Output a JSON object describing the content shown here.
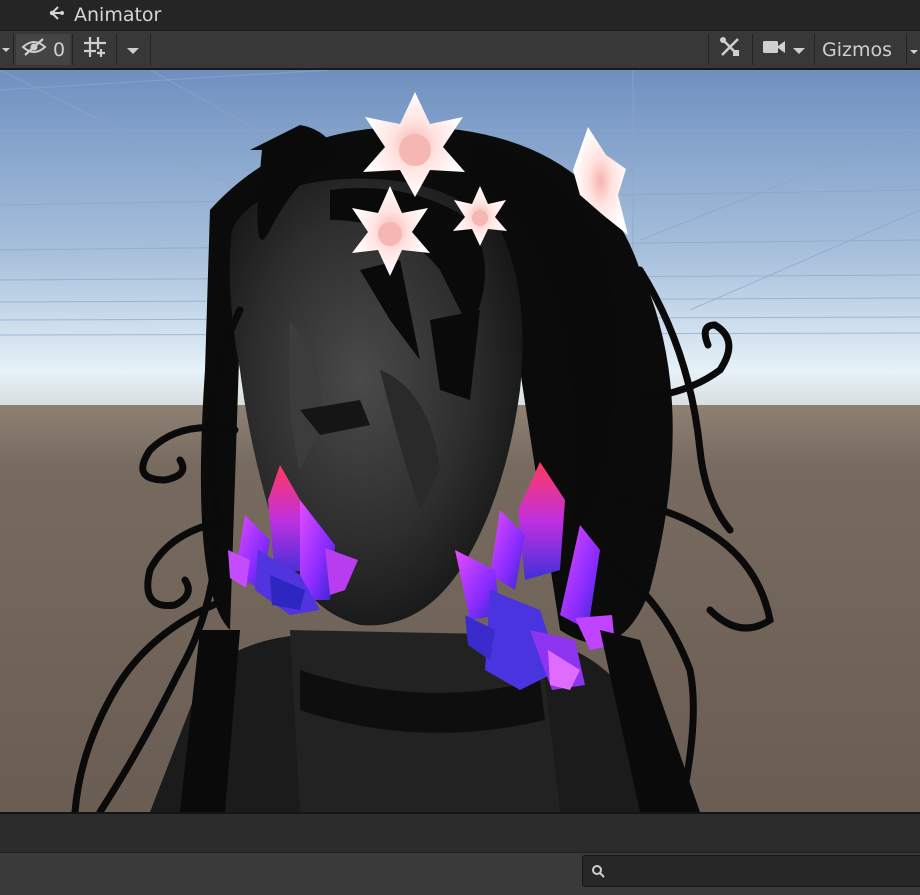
{
  "window": {
    "tab_label": "Animator",
    "tab_icon": "animator-icon"
  },
  "toolbar": {
    "hidden_count": "0",
    "gizmos_label": "Gizmos"
  },
  "search": {
    "placeholder": "",
    "value": ""
  },
  "colors": {
    "toolbar_bg": "#383838",
    "tab_bg": "#252525",
    "sky_top": "#6f90c0",
    "horizon": "#e6f1f8",
    "ground": "#6f6259",
    "crystal_pink": "#ff3a6e",
    "crystal_violet": "#9a2cff",
    "crystal_blue": "#3b2ccf",
    "flower": "#ffe9e7"
  }
}
